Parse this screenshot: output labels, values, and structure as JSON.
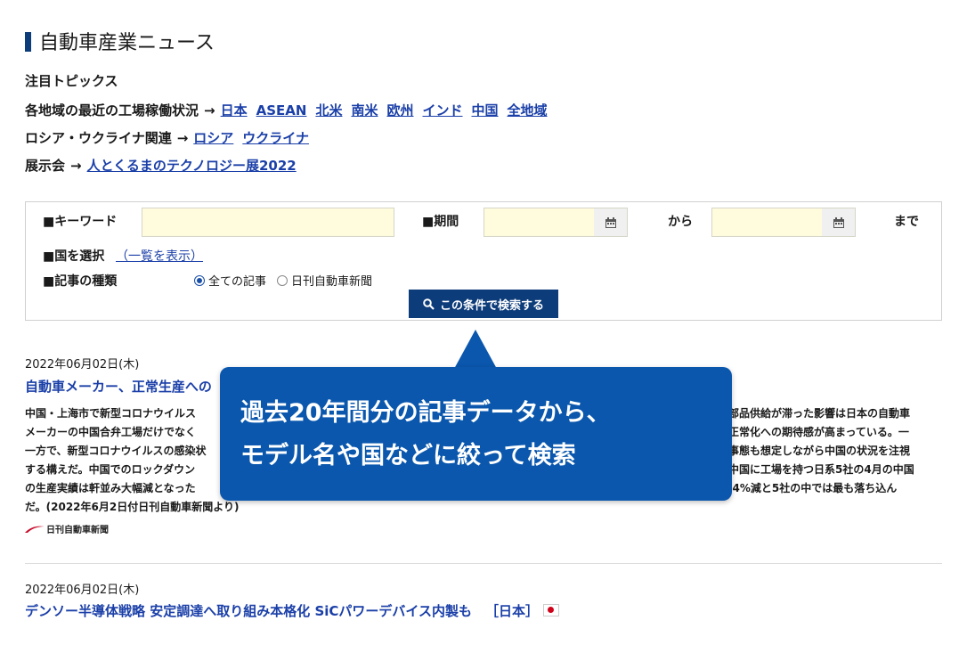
{
  "page_title": "自動車産業ニュース",
  "topics": {
    "heading": "注目トピックス",
    "rows": [
      {
        "label": "各地域の最近の工場稼働状況",
        "arrow": "→",
        "links": [
          "日本",
          "ASEAN",
          "北米",
          "南米",
          "欧州",
          "インド",
          "中国",
          "全地域"
        ]
      },
      {
        "label": "ロシア・ウクライナ関連",
        "arrow": "→",
        "links": [
          "ロシア",
          "ウクライナ"
        ]
      },
      {
        "label": "展示会",
        "arrow": "→",
        "links": [
          "人とくるまのテクノロジー展2022"
        ]
      }
    ]
  },
  "search": {
    "keyword_label": "■キーワード",
    "keyword_value": "",
    "period_label": "■期間",
    "from_value": "",
    "from_suffix": "から",
    "to_value": "",
    "to_suffix": "まで",
    "country_label": "■国を選択",
    "country_link": "（一覧を表示）",
    "type_label": "■記事の種類",
    "type_options": [
      "全ての記事",
      "日刊自動車新聞"
    ],
    "type_selected": "全ての記事",
    "button_label": "この条件で検索する"
  },
  "articles": [
    {
      "date": "2022年06月02日(木)",
      "headline": "自動車メーカー、正常生産への",
      "body_left": [
        "中国・上海市で新型コロナウイルス",
        "メーカーの中国合弁工場だけでなく",
        "一方で、新型コロナウイルスの感染状",
        "する構えだ。中国でのロックダウン",
        "の生産実績は軒並み大幅減となった",
        "だ。(2022年6月2日付日刊自動車新聞より)"
      ],
      "body_right": [
        "部品供給が滞った影響は日本の自動車",
        "正常化への期待感が高まっている。一",
        "事態も想定しながら中国の状況を注視",
        "中国に工場を持つ日系5社の4月の中国",
        ".4%減と5社の中では最も落ち込ん"
      ],
      "source_logo": "日刊自動車新聞"
    },
    {
      "date": "2022年06月02日(木)",
      "headline": "デンソー半導体戦略 安定調達へ取り組み本格化 SiCパワーデバイス内製も",
      "tag": "［日本］"
    }
  ],
  "callout": {
    "lines": [
      "過去20年間分の記事データから、",
      "モデル名や国などに絞って検索"
    ],
    "color": "#0a57ad"
  },
  "colors": {
    "accent": "#0d3c7a",
    "link": "#1a3fa8",
    "input_bg": "#fffbdd"
  }
}
